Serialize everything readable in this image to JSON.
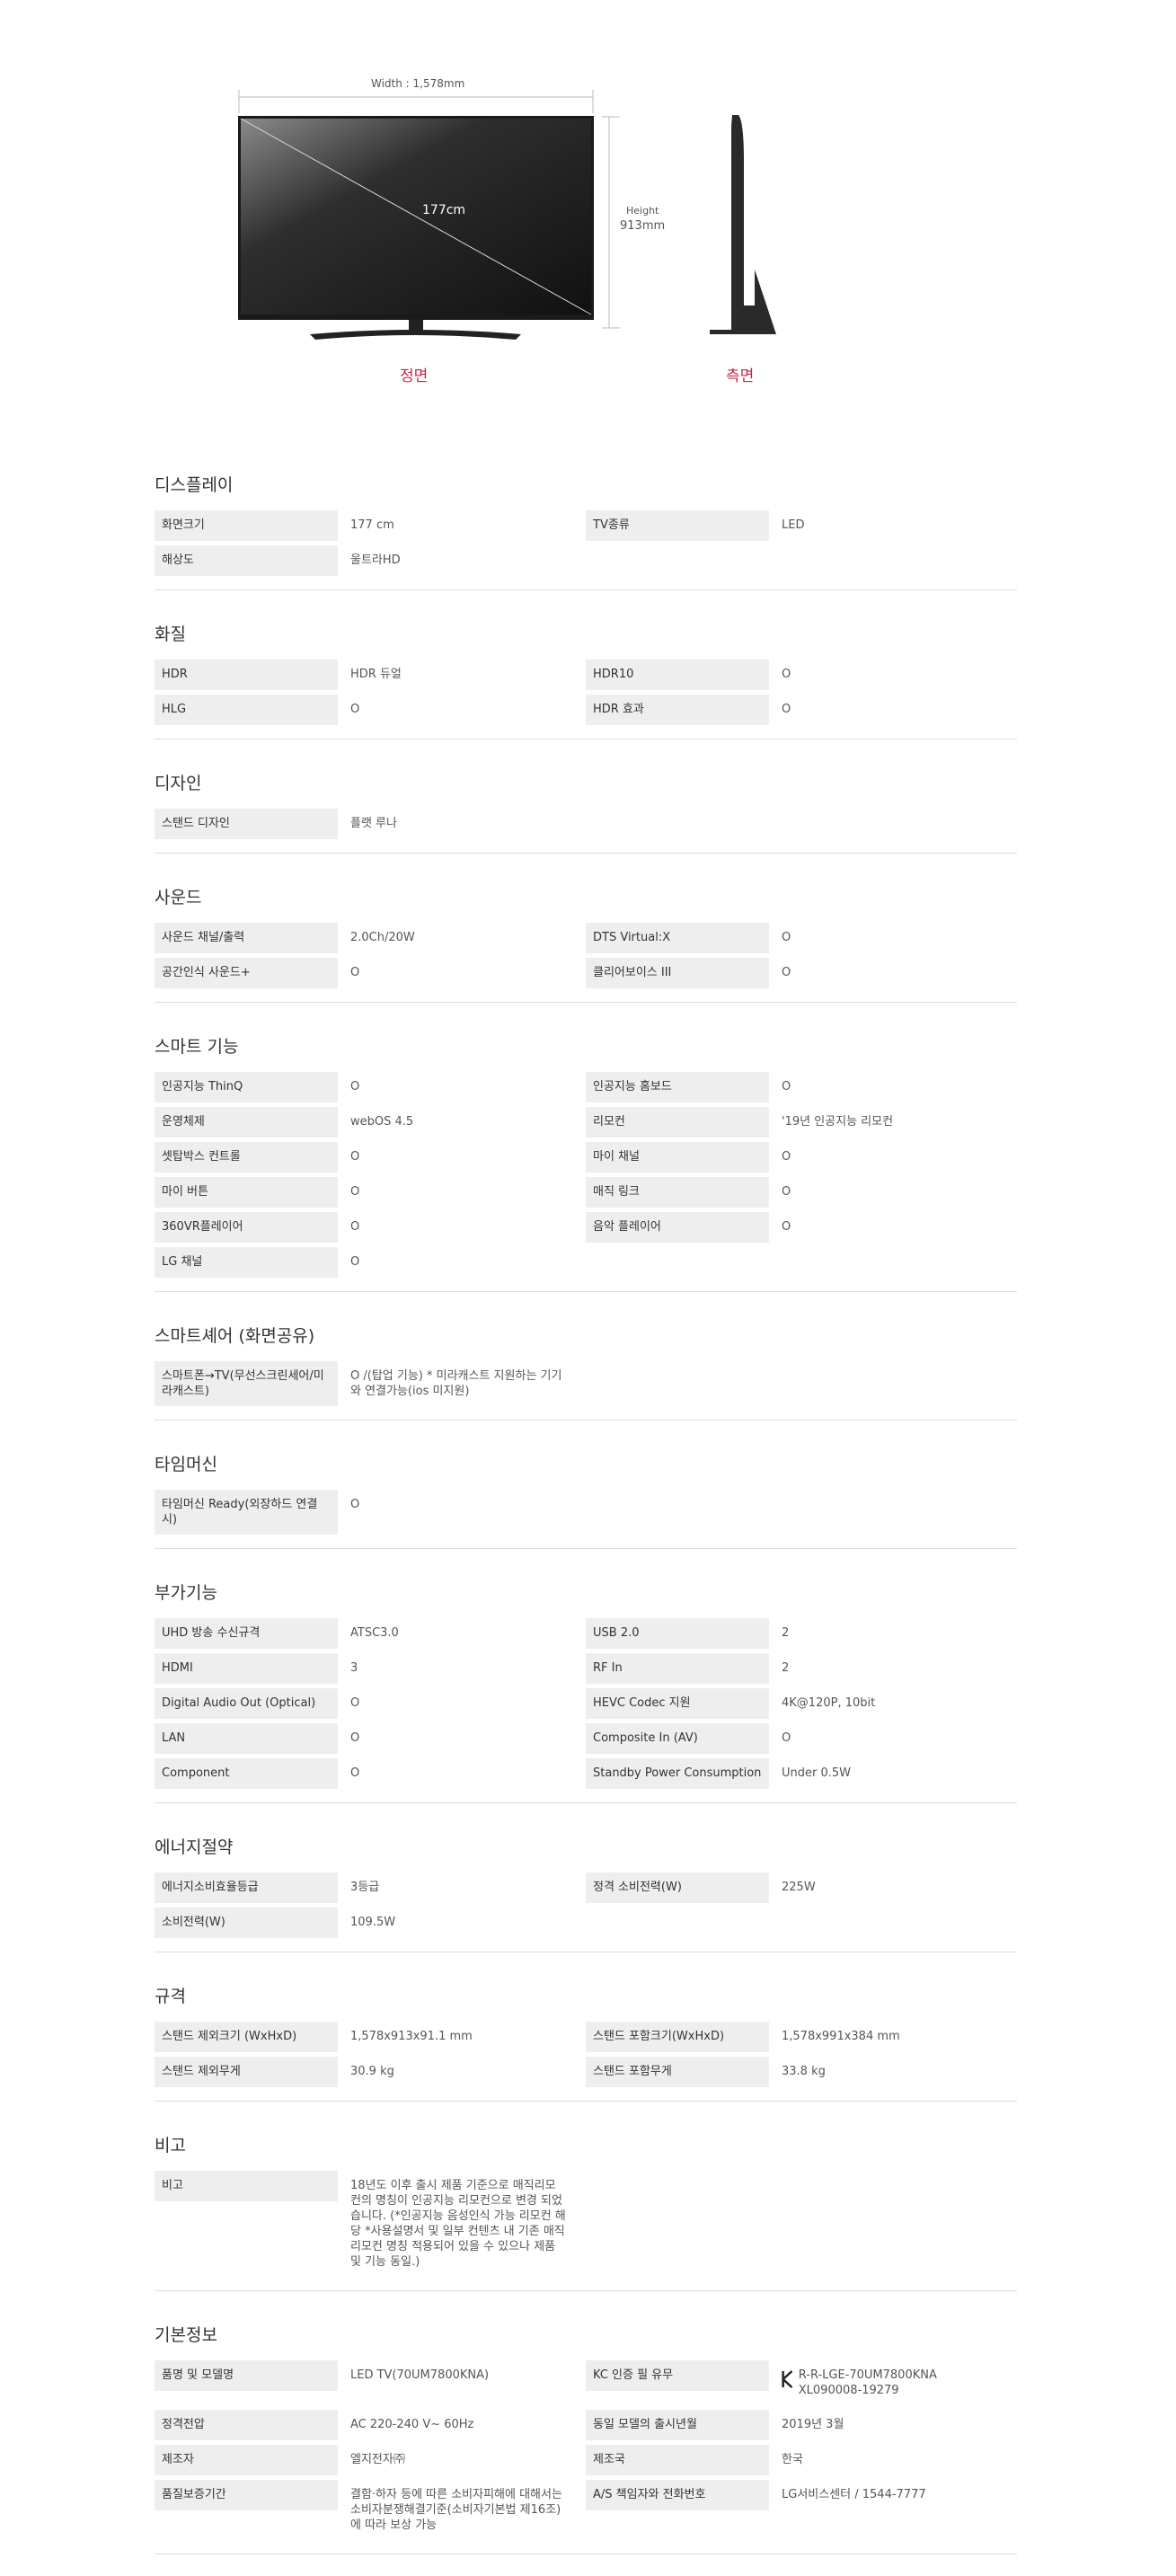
{
  "diagram": {
    "width_label": "Width : 1,578mm",
    "diagonal_label": "177cm",
    "height_label_top": "Height",
    "height_label_bottom": "913mm",
    "front_label": "정면",
    "side_label": "측면"
  },
  "sections": [
    {
      "title": "디스플레이",
      "rows": [
        {
          "key": "화면크기",
          "value": "177 cm"
        },
        {
          "key": "TV종류",
          "value": "LED"
        },
        {
          "key": "해상도",
          "value": "울트라HD"
        }
      ]
    },
    {
      "title": "화질",
      "rows": [
        {
          "key": "HDR",
          "value": "HDR 듀얼"
        },
        {
          "key": "HDR10",
          "value": "O"
        },
        {
          "key": "HLG",
          "value": "O"
        },
        {
          "key": "HDR 효과",
          "value": "O"
        }
      ]
    },
    {
      "title": "디자인",
      "rows": [
        {
          "key": "스탠드 디자인",
          "value": "플랫 루나"
        }
      ]
    },
    {
      "title": "사운드",
      "rows": [
        {
          "key": "사운드 채널/출력",
          "value": "2.0Ch/20W"
        },
        {
          "key": "DTS Virtual:X",
          "value": "O"
        },
        {
          "key": "공간인식 사운드+",
          "value": "O"
        },
        {
          "key": "클리어보이스 III",
          "value": "O"
        }
      ]
    },
    {
      "title": "스마트 기능",
      "rows": [
        {
          "key": "인공지능 ThinQ",
          "value": "O"
        },
        {
          "key": "인공지능 홈보드",
          "value": "O"
        },
        {
          "key": "운영체제",
          "value": "webOS 4.5"
        },
        {
          "key": "리모컨",
          "value": "'19년 인공지능 리모컨"
        },
        {
          "key": "셋탑박스 컨트롤",
          "value": "O"
        },
        {
          "key": "마이 채널",
          "value": "O"
        },
        {
          "key": "마이 버튼",
          "value": "O"
        },
        {
          "key": "매직 링크",
          "value": "O"
        },
        {
          "key": "360VR플레이어",
          "value": "O"
        },
        {
          "key": "음악 플레이어",
          "value": "O"
        },
        {
          "key": "LG 채널",
          "value": "O"
        }
      ]
    },
    {
      "title": "스마트셰어 (화면공유)",
      "rows": [
        {
          "key": "스마트폰→TV(무선스크린세어/미라캐스트)",
          "value": "O /(탑업 기능) * 미라캐스트 지원하는 기기와 연결가능(ios 미지원)"
        }
      ]
    },
    {
      "title": "타임머신",
      "rows": [
        {
          "key": "타임머신 Ready(외장하드 연결시)",
          "value": "O"
        }
      ]
    },
    {
      "title": "부가기능",
      "rows": [
        {
          "key": "UHD 방송 수신규격",
          "value": "ATSC3.0"
        },
        {
          "key": "USB 2.0",
          "value": "2"
        },
        {
          "key": "HDMI",
          "value": "3"
        },
        {
          "key": "RF In",
          "value": "2"
        },
        {
          "key": "Digital Audio Out (Optical)",
          "value": "O"
        },
        {
          "key": "HEVC Codec 지원",
          "value": "4K@120P, 10bit"
        },
        {
          "key": "LAN",
          "value": "O"
        },
        {
          "key": "Composite In (AV)",
          "value": "O"
        },
        {
          "key": "Component",
          "value": "O"
        },
        {
          "key": "Standby Power Consumption",
          "value": "Under 0.5W"
        }
      ]
    },
    {
      "title": "에너지절약",
      "rows": [
        {
          "key": "에너지소비효율등급",
          "value": "3등급"
        },
        {
          "key": "정격 소비전력(W)",
          "value": "225W"
        },
        {
          "key": "소비전력(W)",
          "value": "109.5W"
        }
      ]
    },
    {
      "title": "규격",
      "rows": [
        {
          "key": "스탠드 제외크기 (WxHxD)",
          "value": "1,578x913x91.1 mm"
        },
        {
          "key": "스탠드 포함크기(WxHxD)",
          "value": "1,578x991x384 mm"
        },
        {
          "key": "스탠드 제외무게",
          "value": "30.9 kg"
        },
        {
          "key": "스탠드 포함무게",
          "value": "33.8 kg"
        }
      ]
    },
    {
      "title": "비고",
      "rows": [
        {
          "key": "비고",
          "value": "18년도 이후 출시 제품 기준으로 매직리모컨의 명칭이 인공지능 리모컨으로 변경 되었습니다. (*인공지능 음성인식 가능 리모컨 해당 *사용설명서 및 일부 컨텐츠 내 기존 매직리모컨 명칭 적용되어 있을 수 있으나 제품 및 기능 동일.)"
        }
      ]
    },
    {
      "title": "기본정보",
      "rows": [
        {
          "key": "품명 및 모델명",
          "value": "LED TV(70UM7800KNA)"
        },
        {
          "key": "KC 인증 필 유무",
          "value": "R-R-LGE-70UM7800KNA XL090008-19279",
          "kc": true
        },
        {
          "key": "정격전압",
          "value": "AC 220-240 V~ 60Hz"
        },
        {
          "key": "동일 모델의 출시년월",
          "value": "2019년 3월"
        },
        {
          "key": "제조자",
          "value": "엘지전자㈜"
        },
        {
          "key": "제조국",
          "value": "한국"
        },
        {
          "key": "품질보증기간",
          "value": "결함·하자 등에 따른 소비자피해에 대해서는 소비자분쟁해결기준(소비자기본법 제16조)에 따라 보상 가능"
        },
        {
          "key": "A/S 책임자와 전화번호",
          "value": "LG서비스센터 / 1544-7777"
        }
      ]
    }
  ]
}
